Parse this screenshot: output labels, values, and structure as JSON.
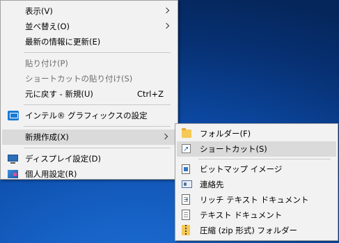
{
  "context_menu": {
    "items": [
      {
        "label": "表示(V)",
        "has_submenu": true
      },
      {
        "label": "並べ替え(O)",
        "has_submenu": true
      },
      {
        "label": "最新の情報に更新(E)"
      },
      {
        "label": "貼り付け(P)",
        "disabled": true
      },
      {
        "label": "ショートカットの貼り付け(S)",
        "disabled": true
      },
      {
        "label": "元に戻す - 新規(U)",
        "shortcut": "Ctrl+Z"
      },
      {
        "label": "インテル® グラフィックスの設定",
        "icon": "intel-graphics-icon"
      },
      {
        "label": "新規作成(X)",
        "has_submenu": true,
        "highlighted": true
      },
      {
        "label": "ディスプレイ設定(D)",
        "icon": "display-settings-icon"
      },
      {
        "label": "個人用設定(R)",
        "icon": "personalize-icon"
      }
    ]
  },
  "new_submenu": {
    "items": [
      {
        "label": "フォルダー(F)",
        "icon": "folder-icon"
      },
      {
        "label": "ショートカット(S)",
        "icon": "shortcut-icon",
        "highlighted": true
      },
      {
        "label": "ビットマップ イメージ",
        "icon": "bitmap-icon"
      },
      {
        "label": "連絡先",
        "icon": "contact-icon"
      },
      {
        "label": "リッチ テキスト ドキュメント",
        "icon": "rich-text-document-icon"
      },
      {
        "label": "テキスト ドキュメント",
        "icon": "text-document-icon"
      },
      {
        "label": "圧縮 (zip 形式) フォルダー",
        "icon": "zip-folder-icon"
      }
    ]
  },
  "colors": {
    "menu_background": "#f2f2f2",
    "highlight": "#dadada",
    "disabled_text": "#6d6d6d",
    "desktop_blue": "#0c49a3"
  }
}
